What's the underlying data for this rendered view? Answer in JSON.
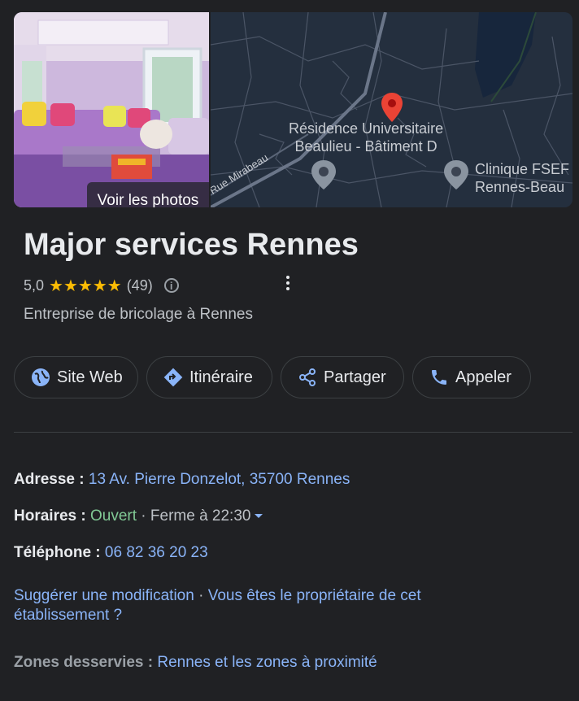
{
  "photo": {
    "label": "Voir les photos"
  },
  "map": {
    "street_label": "Rue Mirabeau",
    "place1_line1": "Résidence Universitaire",
    "place1_line2": "Beaulieu - Bâtiment D",
    "place2_line1": "Clinique FSEF",
    "place2_line2": "Rennes-Beau"
  },
  "business": {
    "name": "Major services Rennes",
    "rating": "5,0",
    "stars": "★★★★★",
    "review_count": "(49)",
    "info_glyph": "i",
    "category": "Entreprise de bricolage à Rennes"
  },
  "actions": [
    {
      "label": "Site Web",
      "icon": "globe-icon"
    },
    {
      "label": "Itinéraire",
      "icon": "directions-icon"
    },
    {
      "label": "Partager",
      "icon": "share-icon"
    },
    {
      "label": "Appeler",
      "icon": "phone-icon"
    }
  ],
  "details": {
    "address_label": "Adresse :",
    "address_value": "13 Av. Pierre Donzelot, 35700 Rennes",
    "hours_label": "Horaires :",
    "hours_status": "Ouvert",
    "hours_sep": " · ",
    "hours_close": "Ferme à 22:30",
    "phone_label": "Téléphone :",
    "phone_value": "06 82 36 20 23"
  },
  "links": {
    "suggest": "Suggérer une modification",
    "sep": " · ",
    "owner": "Vous êtes le propriétaire de cet établissement ?"
  },
  "zones": {
    "label": "Zones desservies :",
    "value": "Rennes et les zones à proximité"
  },
  "colors": {
    "background": "#202124",
    "link": "#8ab4f8",
    "open": "#81c995",
    "star": "#fbbc04",
    "pin": "#ea4335"
  }
}
